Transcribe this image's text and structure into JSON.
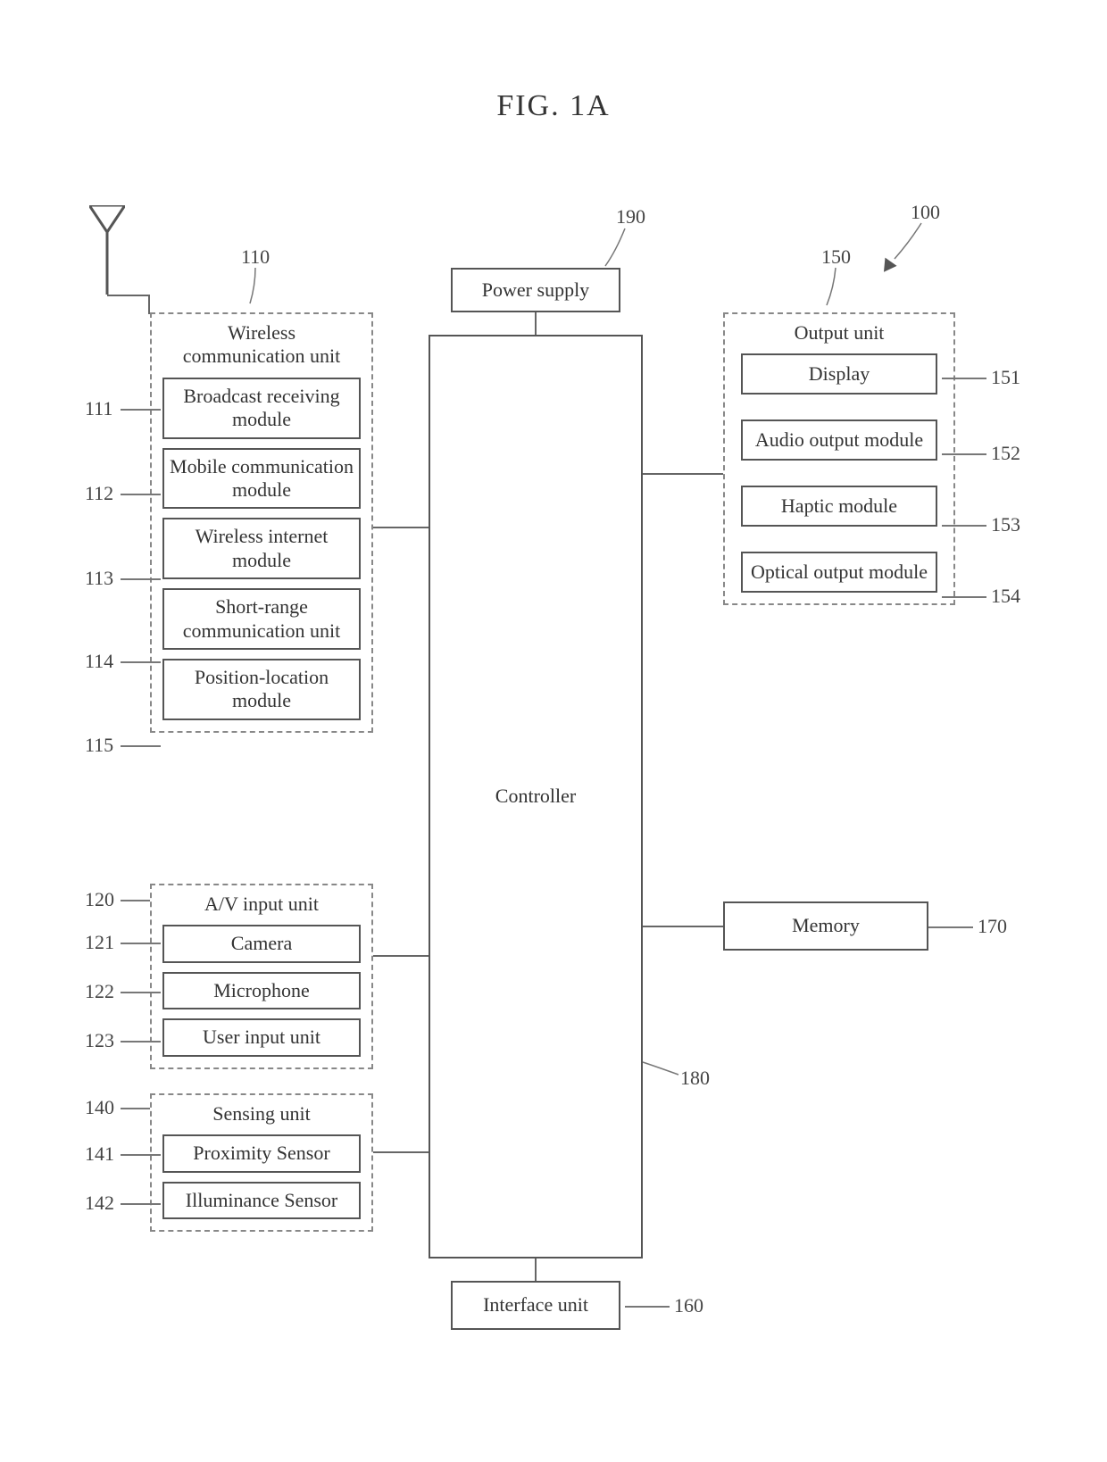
{
  "figure_title": "FIG. 1A",
  "refs": {
    "r100": "100",
    "r110": "110",
    "r111": "111",
    "r112": "112",
    "r113": "113",
    "r114": "114",
    "r115": "115",
    "r120": "120",
    "r121": "121",
    "r122": "122",
    "r123": "123",
    "r140": "140",
    "r141": "141",
    "r142": "142",
    "r150": "150",
    "r151": "151",
    "r152": "152",
    "r153": "153",
    "r154": "154",
    "r160": "160",
    "r170": "170",
    "r180": "180",
    "r190": "190"
  },
  "blocks": {
    "power_supply": "Power supply",
    "controller": "Controller",
    "memory": "Memory",
    "interface_unit": "Interface unit"
  },
  "wireless": {
    "title": "Wireless\ncommunication unit",
    "items": {
      "broadcast": "Broadcast receiving\nmodule",
      "mobile": "Mobile communication\nmodule",
      "internet": "Wireless internet\nmodule",
      "short_range": "Short-range\ncommunication unit",
      "position": "Position-location\nmodule"
    }
  },
  "av_input": {
    "title": "A/V input unit",
    "items": {
      "camera": "Camera",
      "microphone": "Microphone",
      "user_input": "User input unit"
    }
  },
  "sensing": {
    "title": "Sensing unit",
    "items": {
      "proximity": "Proximity Sensor",
      "illuminance": "Illuminance Sensor"
    }
  },
  "output": {
    "title": "Output unit",
    "items": {
      "display": "Display",
      "audio": "Audio output module",
      "haptic": "Haptic module",
      "optical": "Optical output module"
    }
  }
}
